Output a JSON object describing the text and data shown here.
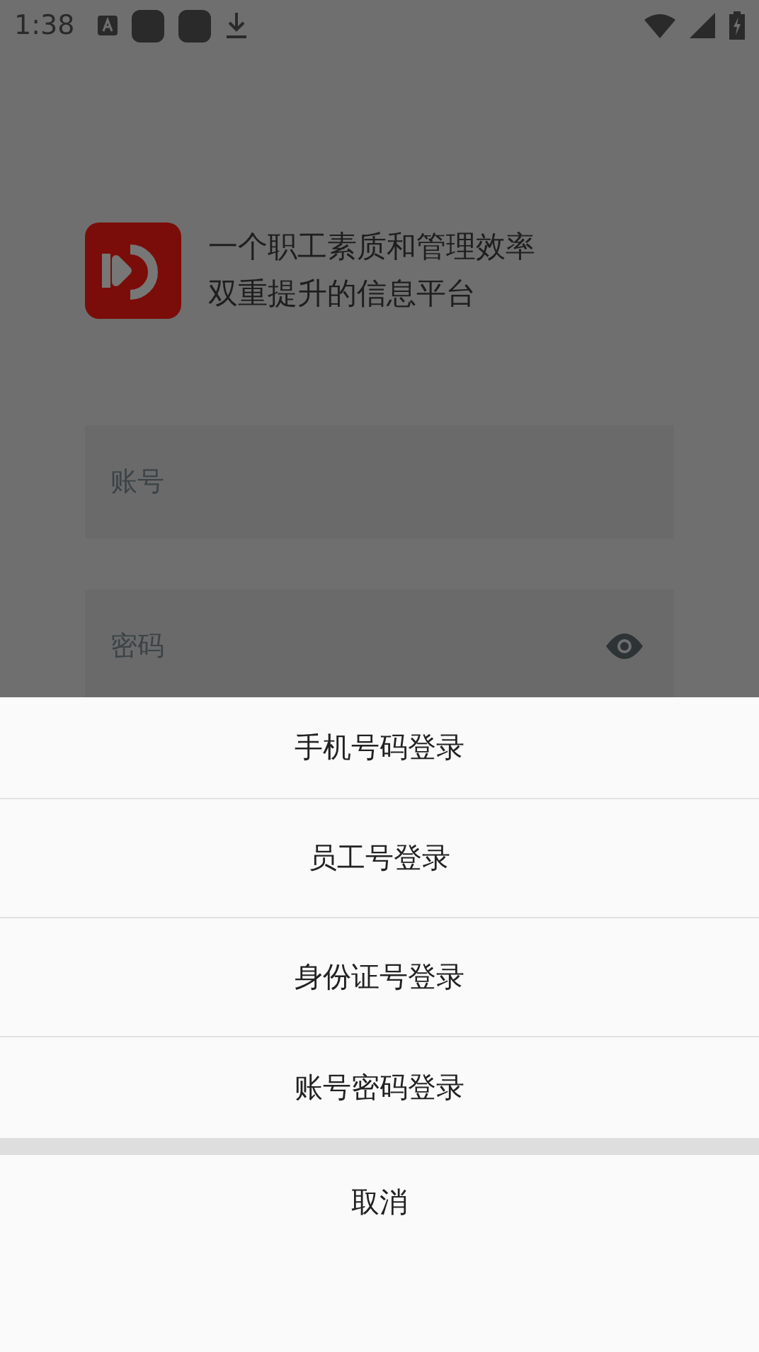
{
  "status_bar": {
    "time": "1:38"
  },
  "app": {
    "slogan_lines": [
      "一个职工素质和管理效率",
      "双重提升的信息平台"
    ]
  },
  "form": {
    "fields": [
      {
        "placeholder": "账号",
        "kind": "text"
      },
      {
        "placeholder": "密码",
        "kind": "password"
      }
    ]
  },
  "action_sheet": {
    "options": [
      "手机号码登录",
      "员工号登录",
      "身份证号登录",
      "账号密码登录"
    ],
    "cancel": "取消"
  }
}
